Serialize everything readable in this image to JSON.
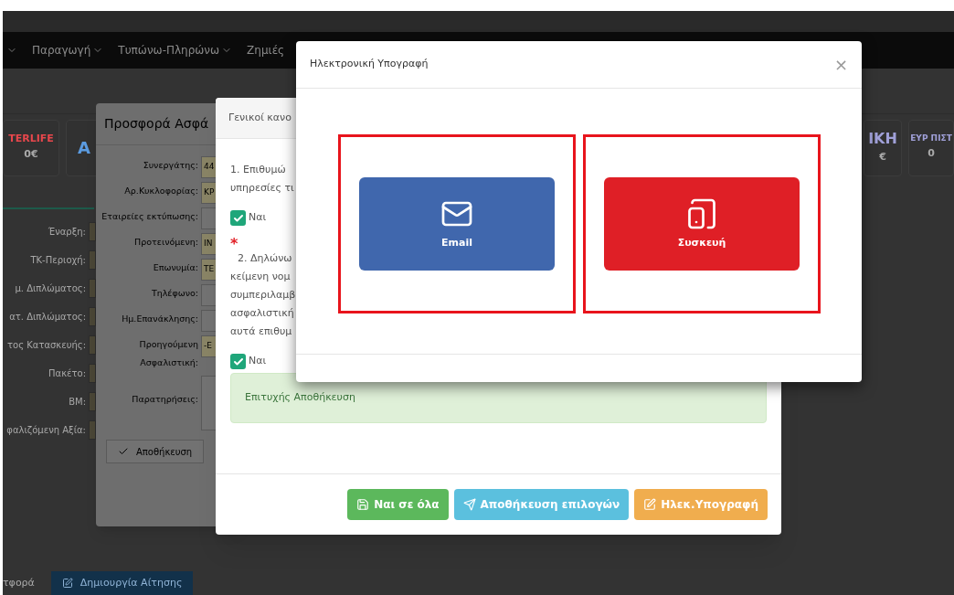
{
  "navbar": {
    "items": [
      {
        "label": "Παραγωγή",
        "dropdown": true
      },
      {
        "label": "Τυπώνω-Πληρώνω",
        "dropdown": true
      },
      {
        "label": "Ζημιές",
        "dropdown": false
      }
    ]
  },
  "company_cards_left": [
    {
      "logo": "TERLIFE",
      "price": "0€"
    },
    {
      "logo": "Α"
    }
  ],
  "company_cards_right": [
    {
      "logo": "ΙΚΗ",
      "price": "€"
    },
    {
      "logo": "ΕΥΡ ΠΙΣΤ",
      "price": "0"
    }
  ],
  "background_form": {
    "fields": [
      {
        "label": "Έναρξη:"
      },
      {
        "label": "ΤΚ-Περιοχή:"
      },
      {
        "label": "μ. Διπλώματος:"
      },
      {
        "label": "ατ. Διπλώματος:"
      },
      {
        "label": "τος Κατασκευής:"
      },
      {
        "label": "Πακέτο:"
      },
      {
        "label": "ΒΜ:"
      },
      {
        "label": "φαλιζόμενη Αξία:"
      }
    ]
  },
  "bottom_tabs": [
    {
      "label": "τφορά",
      "selected": false
    },
    {
      "label": "Δημιουργία Αίτησης",
      "selected": true
    }
  ],
  "offer_dialog": {
    "title": "Προσφορά Ασφά",
    "fields": [
      {
        "label": "Συνεργάτης:",
        "value": "44"
      },
      {
        "label": "Αρ.Κυκλοφορίας:",
        "value": "ΚΡ"
      },
      {
        "label": "Εταιρείες εκτύπωσης:"
      },
      {
        "label": "Προτεινόμενη:",
        "value": "IN"
      },
      {
        "label": "Επωνυμία:",
        "value": "ΤΕ"
      },
      {
        "label": "Τηλέφωνο:"
      },
      {
        "label": "Ημ.Επανάκλησης:"
      },
      {
        "label": "Προηγούμενη Ασφαλιστική:",
        "value": "-Ε"
      },
      {
        "label": "Παρατηρήσεις:"
      }
    ],
    "save_button": "Αποθήκευση"
  },
  "terms_dialog": {
    "title": "Γενικοί κανο",
    "questions": [
      {
        "lines": [
          "1. Επιθυμώ",
          "υπηρεσίες τι"
        ],
        "answer": {
          "label": "Ναι",
          "checked": true
        }
      },
      {
        "required_mark": "*",
        "lines": [
          "2. Δηλώνω",
          "κείμενη νομ",
          "συμπεριλαμβ",
          "ασφαλιστική",
          "αυτά επιθυμ"
        ],
        "answer": {
          "label": "Ναι",
          "checked": true
        }
      }
    ],
    "alert": "Επιτυχής Αποθήκευση",
    "buttons": [
      {
        "label": "Ναι σε όλα",
        "kind": "save"
      },
      {
        "label": "Αποθήκευση επιλογών",
        "kind": "send"
      },
      {
        "label": "Ηλεκ.Υπογραφή",
        "kind": "sign"
      }
    ]
  },
  "signature_dialog": {
    "title": "Ηλεκτρονική Υπογραφή",
    "close": "×",
    "options": [
      {
        "label": "Email",
        "kind": "email"
      },
      {
        "label": "Συσκευή",
        "kind": "device"
      }
    ]
  }
}
